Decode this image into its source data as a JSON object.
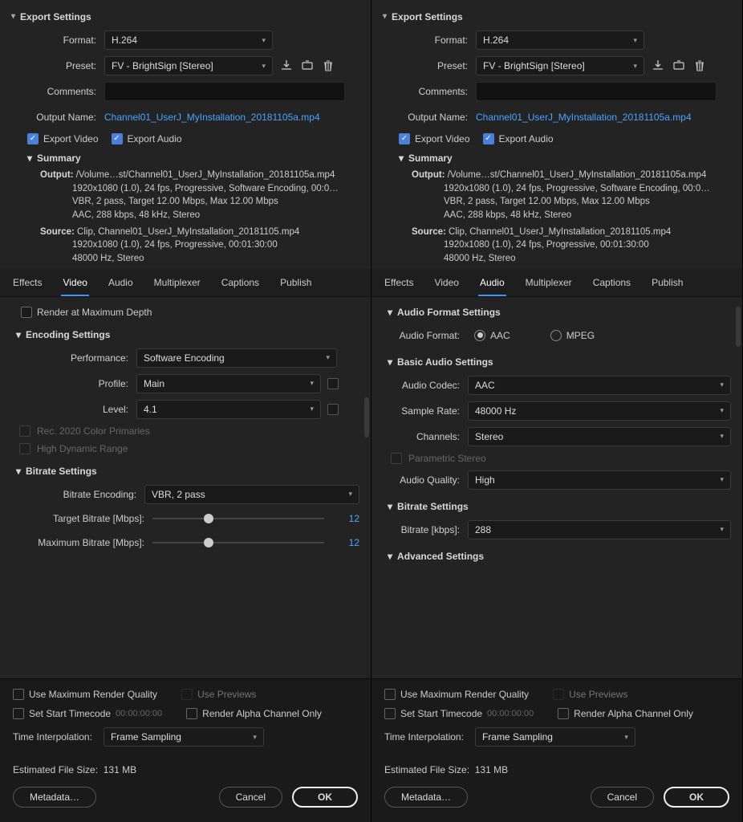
{
  "export": {
    "title": "Export Settings",
    "fields": {
      "format_label": "Format:",
      "format_value": "H.264",
      "preset_label": "Preset:",
      "preset_value": "FV - BrightSign [Stereo]",
      "comments_label": "Comments:",
      "output_name_label": "Output Name:",
      "output_name_value": "Channel01_UserJ_MyInstallation_20181105a.mp4"
    },
    "checks": {
      "export_video": "Export Video",
      "export_audio": "Export Audio"
    },
    "summary": {
      "title": "Summary",
      "output_label": "Output:",
      "output_l1": "/Volume…st/Channel01_UserJ_MyInstallation_20181105a.mp4",
      "output_l2": "1920x1080 (1.0), 24 fps, Progressive, Software Encoding, 00:0…",
      "output_l3": "VBR, 2 pass, Target 12.00 Mbps, Max 12.00 Mbps",
      "output_l4": "AAC, 288 kbps, 48 kHz, Stereo",
      "source_label": "Source:",
      "source_l1": "Clip, Channel01_UserJ_MyInstallation_20181105.mp4",
      "source_l2": "1920x1080 (1.0), 24 fps, Progressive, 00:01:30:00",
      "source_l3": "48000 Hz, Stereo"
    }
  },
  "tabs": [
    "Effects",
    "Video",
    "Audio",
    "Multiplexer",
    "Captions",
    "Publish"
  ],
  "left": {
    "render_max_depth": "Render at Maximum Depth",
    "encoding_title": "Encoding Settings",
    "perf_label": "Performance:",
    "perf_value": "Software Encoding",
    "profile_label": "Profile:",
    "profile_value": "Main",
    "level_label": "Level:",
    "level_value": "4.1",
    "rec2020": "Rec. 2020 Color Primaries",
    "hdr": "High Dynamic Range",
    "bitrate_title": "Bitrate Settings",
    "bitrate_enc_label": "Bitrate Encoding:",
    "bitrate_enc_value": "VBR, 2 pass",
    "target_label": "Target Bitrate [Mbps]:",
    "target_value": "12",
    "max_label": "Maximum Bitrate [Mbps]:",
    "max_value": "12"
  },
  "right": {
    "afs_title": "Audio Format Settings",
    "af_label": "Audio Format:",
    "af_opt1": "AAC",
    "af_opt2": "MPEG",
    "bas_title": "Basic Audio Settings",
    "codec_label": "Audio Codec:",
    "codec_value": "AAC",
    "sr_label": "Sample Rate:",
    "sr_value": "48000 Hz",
    "ch_label": "Channels:",
    "ch_value": "Stereo",
    "param_stereo": "Parametric Stereo",
    "aq_label": "Audio Quality:",
    "aq_value": "High",
    "br_title": "Bitrate Settings",
    "br_label": "Bitrate [kbps]:",
    "br_value": "288",
    "adv_title": "Advanced Settings"
  },
  "bottom": {
    "umrq": "Use Maximum Render Quality",
    "use_prev": "Use Previews",
    "sst": "Set Start Timecode",
    "sst_tc": "00:00:00:00",
    "raco": "Render Alpha Channel Only",
    "ti_label": "Time Interpolation:",
    "ti_value": "Frame Sampling",
    "est_label": "Estimated File Size:",
    "est_value": "131 MB",
    "meta_btn": "Metadata…",
    "cancel_btn": "Cancel",
    "ok_btn": "OK"
  }
}
